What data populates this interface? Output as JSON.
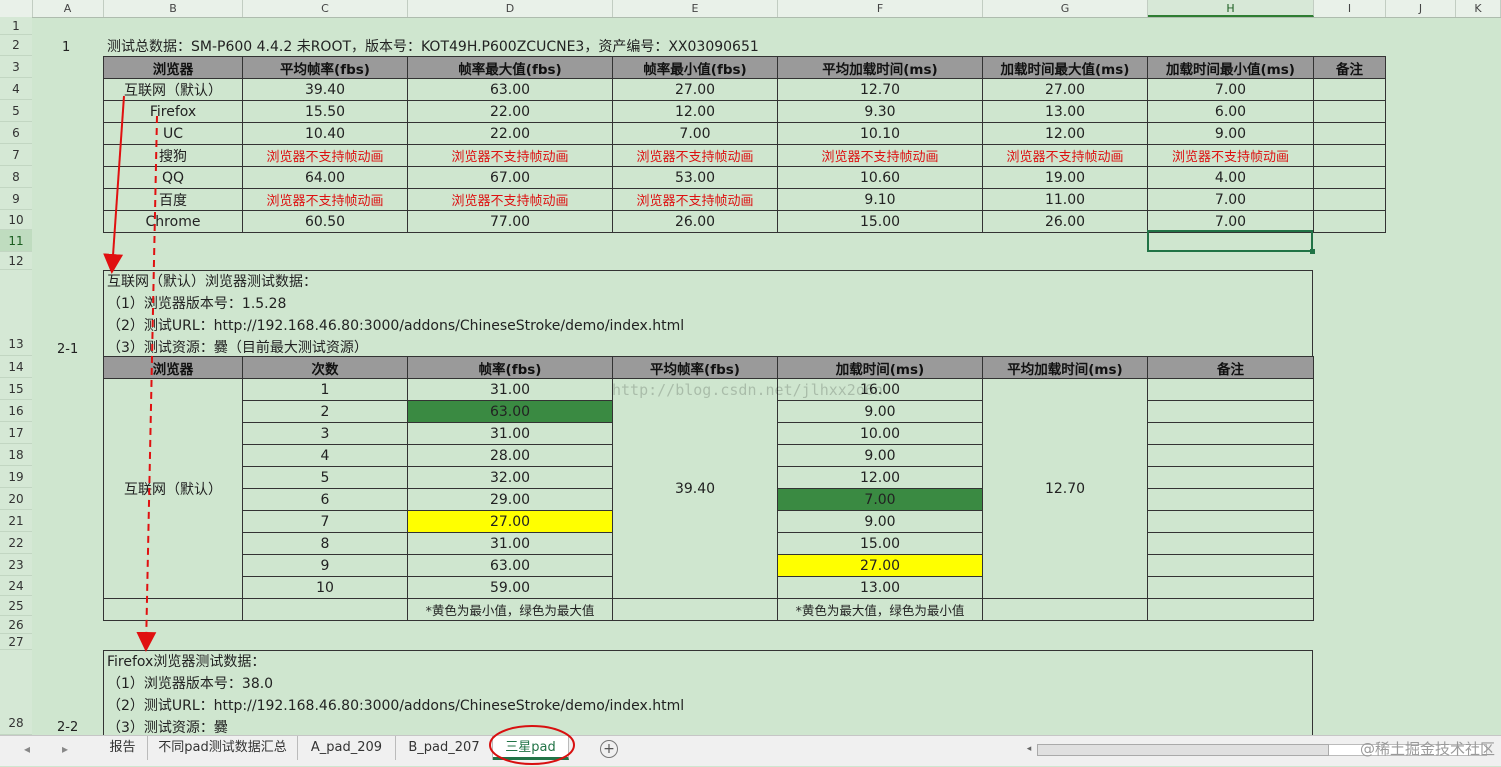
{
  "columns": [
    "A",
    "B",
    "C",
    "D",
    "E",
    "F",
    "G",
    "H",
    "I",
    "J",
    "K"
  ],
  "selected_column": "H",
  "rows": [
    "1",
    "2",
    "3",
    "4",
    "5",
    "6",
    "7",
    "8",
    "9",
    "10",
    "11",
    "12",
    "13",
    "14",
    "15",
    "16",
    "17",
    "18",
    "19",
    "20",
    "21",
    "22",
    "23",
    "24",
    "25",
    "26",
    "27",
    "28"
  ],
  "selected_row": "11",
  "section_labels": {
    "s1": "1",
    "s2": "2-1",
    "s3": "2-2"
  },
  "summary": {
    "title": "测试总数据：SM-P600 4.4.2 未ROOT，版本号：KOT49H.P600ZCUCNE3，资产编号：XX03090651",
    "headers": [
      "浏览器",
      "平均帧率(fbs)",
      "帧率最大值(fbs)",
      "帧率最小值(fbs)",
      "平均加载时间(ms)",
      "加载时间最大值(ms)",
      "加载时间最小值(ms)",
      "备注"
    ],
    "rows": [
      [
        "互联网（默认）",
        "39.40",
        "63.00",
        "27.00",
        "12.70",
        "27.00",
        "7.00",
        ""
      ],
      [
        "Firefox",
        "15.50",
        "22.00",
        "12.00",
        "9.30",
        "13.00",
        "6.00",
        ""
      ],
      [
        "UC",
        "10.40",
        "22.00",
        "7.00",
        "10.10",
        "12.00",
        "9.00",
        ""
      ],
      [
        "搜狗",
        "浏览器不支持帧动画",
        "浏览器不支持帧动画",
        "浏览器不支持帧动画",
        "浏览器不支持帧动画",
        "浏览器不支持帧动画",
        "浏览器不支持帧动画",
        ""
      ],
      [
        "QQ",
        "64.00",
        "67.00",
        "53.00",
        "10.60",
        "19.00",
        "4.00",
        ""
      ],
      [
        "百度",
        "浏览器不支持帧动画",
        "浏览器不支持帧动画",
        "浏览器不支持帧动画",
        "9.10",
        "11.00",
        "7.00",
        ""
      ],
      [
        "Chrome",
        "60.50",
        "77.00",
        "26.00",
        "15.00",
        "26.00",
        "7.00",
        ""
      ]
    ],
    "unsupported_text": "浏览器不支持帧动画"
  },
  "section1": {
    "lines": [
      "互联网（默认）浏览器测试数据：",
      "（1）浏览器版本号：1.5.28",
      "（2）测试URL：http://192.168.46.80:3000/addons/ChineseStroke/demo/index.html",
      "（3）测试资源：爨（目前最大测试资源）"
    ],
    "headers": [
      "浏览器",
      "次数",
      "帧率(fbs)",
      "平均帧率(fbs)",
      "加载时间(ms)",
      "平均加载时间(ms)",
      "备注"
    ],
    "browser": "互联网（默认）",
    "counts": [
      "1",
      "2",
      "3",
      "4",
      "5",
      "6",
      "7",
      "8",
      "9",
      "10"
    ],
    "fps": [
      "31.00",
      "63.00",
      "31.00",
      "28.00",
      "32.00",
      "29.00",
      "27.00",
      "31.00",
      "63.00",
      "59.00"
    ],
    "load": [
      "16.00",
      "9.00",
      "10.00",
      "9.00",
      "12.00",
      "7.00",
      "9.00",
      "15.00",
      "27.00",
      "13.00"
    ],
    "avg_fps": "39.40",
    "avg_load": "12.70",
    "note_fps": "*黄色为最小值，绿色为最大值",
    "note_load": "*黄色为最大值，绿色为最小值"
  },
  "section2": {
    "lines": [
      "Firefox浏览器测试数据：",
      "（1）浏览器版本号：38.0",
      "（2）测试URL：http://192.168.46.80:3000/addons/ChineseStroke/demo/index.html",
      "（3）测试资源：爨"
    ]
  },
  "watermark": "http://blog.csdn.net/jlhxx2o6n",
  "colors": {
    "yellow": "#ffff00",
    "green": "#3a8a42",
    "red": "#dd1111",
    "header_gray": "#9a9a9a",
    "sheet_bg": "#cfe6cf"
  },
  "tabs": [
    "报告",
    "不同pad测试数据汇总",
    "A_pad_209",
    "B_pad_207",
    "三星pad"
  ],
  "active_tab": "三星pad",
  "footer_mark": "@稀土掘金技术社区"
}
